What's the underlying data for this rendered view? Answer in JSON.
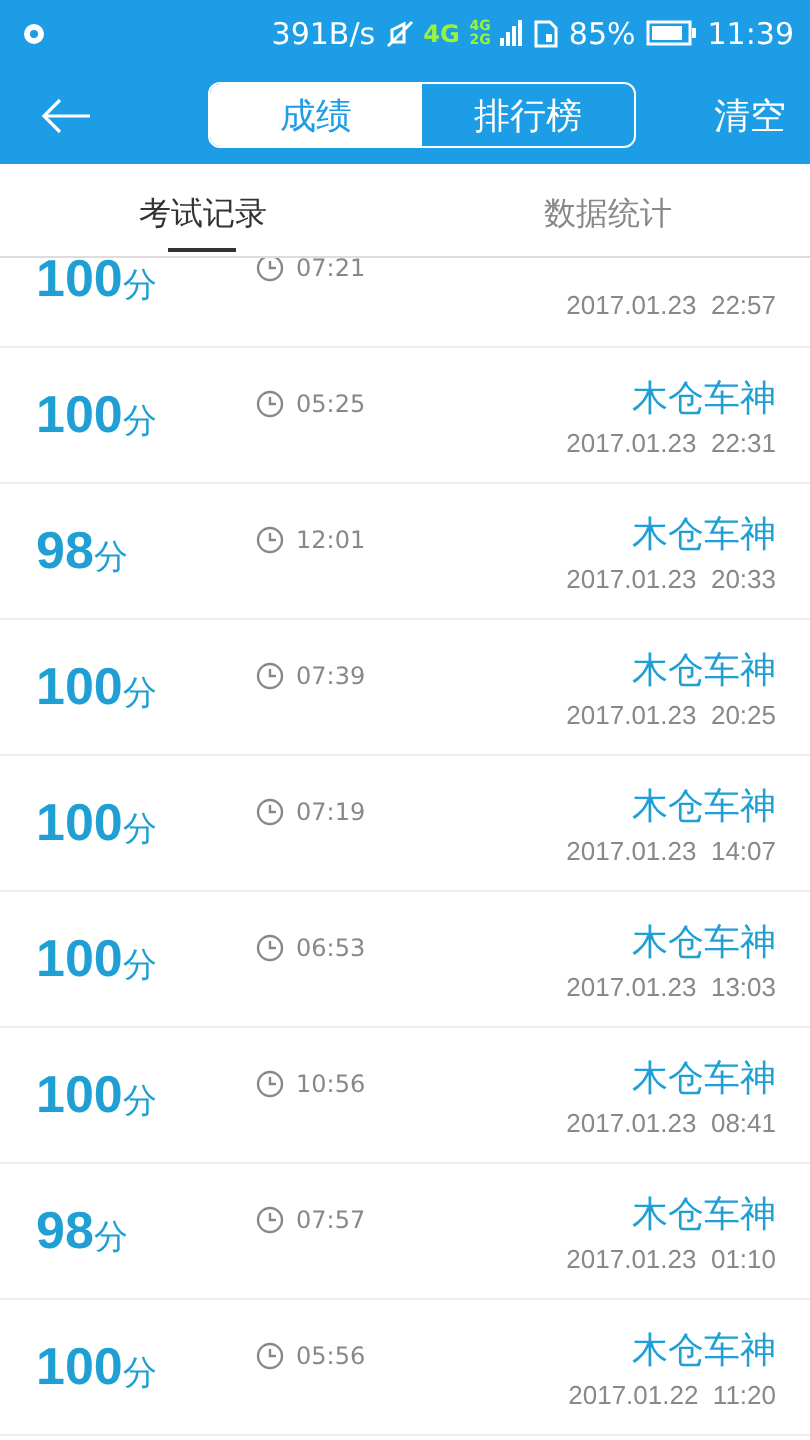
{
  "status_bar": {
    "speed": "391B/s",
    "network": "4G",
    "network_small_top": "4G",
    "network_small_bottom": "2G",
    "battery": "85%",
    "time": "11:39"
  },
  "header": {
    "segments": [
      {
        "label": "成绩",
        "selected": true
      },
      {
        "label": "排行榜",
        "selected": false
      }
    ],
    "action": "清空"
  },
  "tabs": [
    {
      "label": "考试记录",
      "selected": true
    },
    {
      "label": "数据统计",
      "selected": false
    }
  ],
  "records": [
    {
      "score": "100",
      "unit": "分",
      "duration": "07:21",
      "date": "2017.01.23  22:57"
    },
    {
      "score": "100",
      "unit": "分",
      "duration": "05:25",
      "name": "木仓车神",
      "date": "2017.01.23  22:31"
    },
    {
      "score": "98",
      "unit": "分",
      "duration": "12:01",
      "name": "木仓车神",
      "date": "2017.01.23  20:33"
    },
    {
      "score": "100",
      "unit": "分",
      "duration": "07:39",
      "name": "木仓车神",
      "date": "2017.01.23  20:25"
    },
    {
      "score": "100",
      "unit": "分",
      "duration": "07:19",
      "name": "木仓车神",
      "date": "2017.01.23  14:07"
    },
    {
      "score": "100",
      "unit": "分",
      "duration": "06:53",
      "name": "木仓车神",
      "date": "2017.01.23  13:03"
    },
    {
      "score": "100",
      "unit": "分",
      "duration": "10:56",
      "name": "木仓车神",
      "date": "2017.01.23  08:41"
    },
    {
      "score": "98",
      "unit": "分",
      "duration": "07:57",
      "name": "木仓车神",
      "date": "2017.01.23  01:10"
    },
    {
      "score": "100",
      "unit": "分",
      "duration": "05:56",
      "name": "木仓车神",
      "date": "2017.01.22  11:20"
    }
  ]
}
